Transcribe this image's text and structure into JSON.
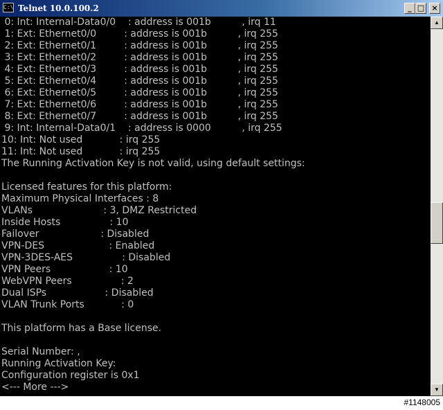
{
  "window": {
    "title": "Telnet 10.0.100.2",
    "icon": "console-icon",
    "icon_text": "C:\\",
    "buttons": {
      "minimize": "_",
      "maximize": "□",
      "close": "×"
    }
  },
  "console": {
    "lines": [
      " 0: Int: Internal-Data0/0    : address is 001b          , irq 11",
      " 1: Ext: Ethernet0/0         : address is 001b          , irq 255",
      " 2: Ext: Ethernet0/1         : address is 001b          , irq 255",
      " 3: Ext: Ethernet0/2         : address is 001b          , irq 255",
      " 4: Ext: Ethernet0/3         : address is 001b          , irq 255",
      " 5: Ext: Ethernet0/4         : address is 001b          , irq 255",
      " 6: Ext: Ethernet0/5         : address is 001b          , irq 255",
      " 7: Ext: Ethernet0/6         : address is 001b          , irq 255",
      " 8: Ext: Ethernet0/7         : address is 001b          , irq 255",
      " 9: Int: Internal-Data0/1    : address is 0000          , irq 255",
      "10: Int: Not used            : irq 255",
      "11: Int: Not used            : irq 255",
      "The Running Activation Key is not valid, using default settings:",
      "",
      "Licensed features for this platform:",
      "Maximum Physical Interfaces : 8",
      "VLANs                       : 3, DMZ Restricted",
      "Inside Hosts                : 10",
      "Failover                    : Disabled",
      "VPN-DES                     : Enabled",
      "VPN-3DES-AES                : Disabled",
      "VPN Peers                   : 10",
      "WebVPN Peers                : 2",
      "Dual ISPs                   : Disabled",
      "VLAN Trunk Ports            : 0",
      "",
      "This platform has a Base license.",
      "",
      "Serial Number: ,",
      "Running Activation Key:",
      "Configuration register is 0x1",
      "<--- More --->"
    ]
  },
  "scrollbar": {
    "up": "▲",
    "down": "▼"
  },
  "watermark": "#1148005"
}
